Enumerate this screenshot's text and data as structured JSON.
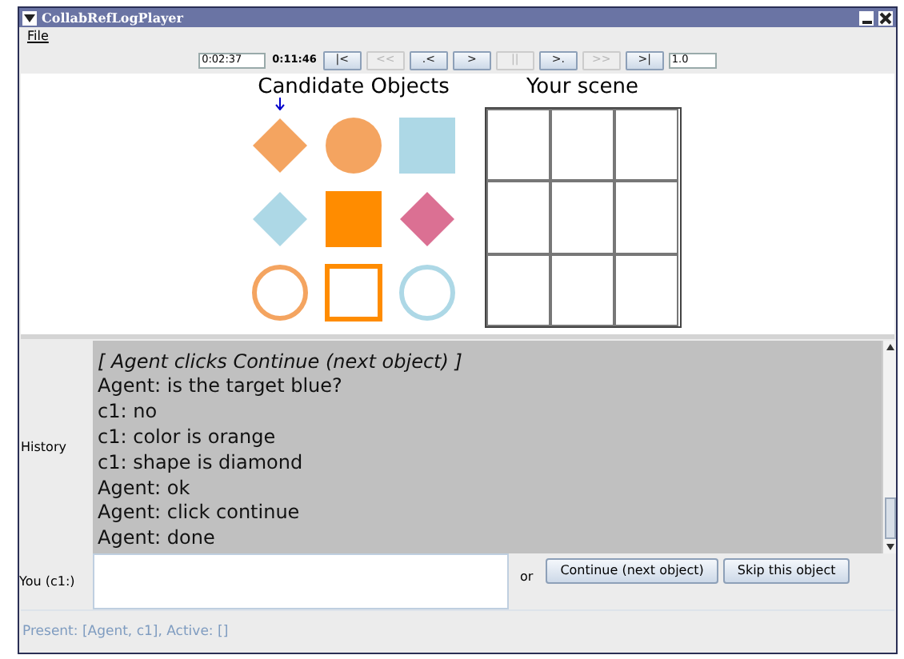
{
  "window": {
    "title": "CollabRefLogPlayer"
  },
  "menu": [
    "File"
  ],
  "toolbar": {
    "current_time": "0:02:37",
    "total_time": "0:11:46",
    "speed": "1.0",
    "buttons": [
      {
        "label": "|<",
        "disabled": false
      },
      {
        "label": "<<",
        "disabled": true
      },
      {
        "label": ".<",
        "disabled": false
      },
      {
        "label": ">",
        "disabled": false
      },
      {
        "label": "||",
        "disabled": true
      },
      {
        "label": ">.",
        "disabled": false
      },
      {
        "label": ">>",
        "disabled": true
      },
      {
        "label": ">|",
        "disabled": false
      }
    ]
  },
  "candidates": {
    "title": "Candidate Objects",
    "objects": [
      {
        "kind": "diamond",
        "color": "#f4a460",
        "filled": true,
        "target": true
      },
      {
        "kind": "circle",
        "color": "#f4a460",
        "filled": true,
        "target": false
      },
      {
        "kind": "square",
        "color": "#add8e6",
        "filled": true,
        "target": false
      },
      {
        "kind": "diamond",
        "color": "#add8e6",
        "filled": true,
        "target": false
      },
      {
        "kind": "square",
        "color": "#ff8c00",
        "filled": true,
        "target": false
      },
      {
        "kind": "diamond",
        "color": "#db7093",
        "filled": true,
        "target": false
      },
      {
        "kind": "circle",
        "color": "#f4a460",
        "filled": false,
        "target": false
      },
      {
        "kind": "square",
        "color": "#ff8c00",
        "filled": false,
        "target": false
      },
      {
        "kind": "circle",
        "color": "#add8e6",
        "filled": false,
        "target": false
      }
    ]
  },
  "scene": {
    "title": "Your scene"
  },
  "history": {
    "label": "History",
    "lines": [
      {
        "kind": "event",
        "text": "[ Agent clicks Continue (next object) ]"
      },
      {
        "kind": "message",
        "text": "Agent: is the target blue?"
      },
      {
        "kind": "message",
        "text": "c1: no"
      },
      {
        "kind": "message",
        "text": "c1: color is orange"
      },
      {
        "kind": "message",
        "text": "c1: shape is diamond"
      },
      {
        "kind": "message",
        "text": "Agent: ok"
      },
      {
        "kind": "message",
        "text": "Agent: click continue"
      },
      {
        "kind": "message",
        "text": "Agent: done"
      }
    ]
  },
  "input": {
    "label": "You (c1:)",
    "or": "or",
    "buttons": [
      "Continue (next object)",
      "Skip this object"
    ]
  },
  "status_bar": "Present: [Agent, c1], Active: []"
}
